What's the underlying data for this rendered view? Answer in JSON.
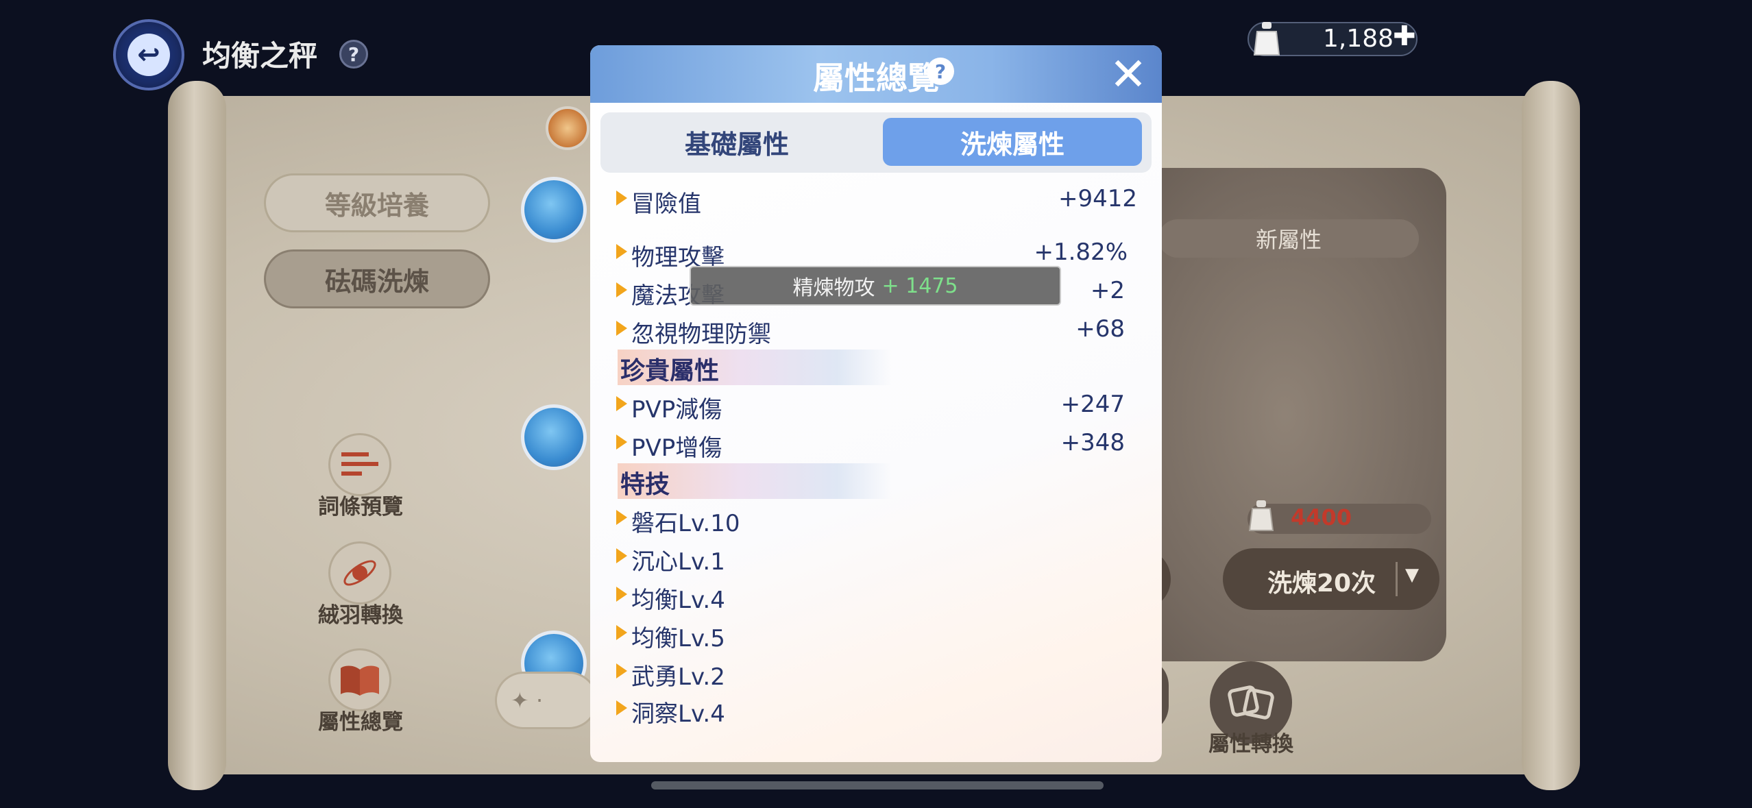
{
  "header": {
    "title": "均衡之秤",
    "help": "?"
  },
  "currency": {
    "value": "1,188",
    "plus": "✚"
  },
  "left_menu": {
    "level_up": "等級培養",
    "refine": "砝碼洗煉",
    "preview": "詞條預覽",
    "feather_convert": "絨羽轉換",
    "attr_overview": "屬性總覽"
  },
  "right_panel": {
    "new_attr": "新屬性",
    "cost": "4400",
    "refine_btn": "洗煉20次",
    "refine_arrow": "▼",
    "convert_label": "屬性轉換"
  },
  "modal": {
    "title": "屬性總覽",
    "help": "?",
    "close": "✕",
    "tabs": {
      "basic": "基礎屬性",
      "refine": "洗煉屬性"
    },
    "attributes": [
      {
        "name": "冒險值",
        "value": "+9412"
      },
      {
        "name": "物理攻擊",
        "value": "+1.82%"
      },
      {
        "name": "魔法攻擊",
        "value": "+2"
      },
      {
        "name": "忽視物理防禦",
        "value": "+68"
      }
    ],
    "precious_header": "珍貴屬性",
    "precious": [
      {
        "name": "PVP減傷",
        "value": "+247"
      },
      {
        "name": "PVP增傷",
        "value": "+348"
      }
    ],
    "skills_header": "特技",
    "skills": [
      "磐石Lv.10",
      "沉心Lv.1",
      "均衡Lv.4",
      "均衡Lv.5",
      "武勇Lv.2",
      "洞察Lv.4"
    ]
  },
  "tooltip": {
    "label": "精煉物攻",
    "value": "+ 1475"
  },
  "colors": {
    "accent_blue": "#6ea0ea",
    "text_navy": "#26356b",
    "bullet_orange": "#f2a51c",
    "cost_red": "#c23a2b"
  }
}
